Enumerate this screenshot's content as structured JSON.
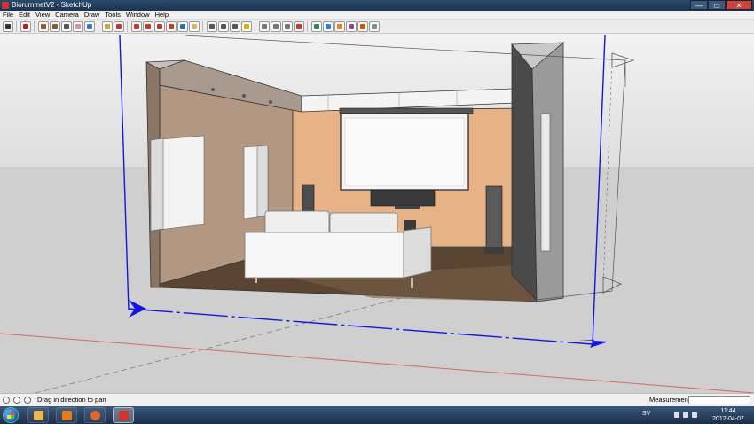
{
  "window": {
    "title": "BiorummetV2 - SketchUp",
    "minimize": "—",
    "maximize": "▭",
    "close": "✕"
  },
  "menu": [
    "File",
    "Edit",
    "View",
    "Camera",
    "Draw",
    "Tools",
    "Window",
    "Help"
  ],
  "toolbar": {
    "tools": [
      {
        "name": "select-tool",
        "color": "#333333"
      },
      {
        "name": "line-tool",
        "color": "#b22222"
      },
      {
        "name": "rectangle-tool",
        "color": "#8b5a2b"
      },
      {
        "name": "circle-tool",
        "color": "#8b5a2b"
      },
      {
        "name": "arc-tool",
        "color": "#555555"
      },
      {
        "name": "eraser-tool",
        "color": "#d98cb3"
      },
      {
        "name": "paint-bucket-tool",
        "color": "#3a7bd5"
      },
      {
        "name": "push-pull-tool",
        "color": "#c8a04a"
      },
      {
        "name": "move-tool",
        "color": "#c0392b"
      },
      {
        "name": "rotate-tool",
        "color": "#c0392b"
      },
      {
        "name": "follow-me-tool",
        "color": "#c0392b"
      },
      {
        "name": "scale-tool",
        "color": "#c0392b"
      },
      {
        "name": "offset-tool",
        "color": "#c0392b"
      },
      {
        "name": "orbit-tool",
        "color": "#2a6fb0"
      },
      {
        "name": "pan-tool",
        "color": "#e0b070"
      },
      {
        "name": "zoom-tool",
        "color": "#555555"
      },
      {
        "name": "zoom-window-tool",
        "color": "#555555"
      },
      {
        "name": "zoom-extents-tool",
        "color": "#555555"
      },
      {
        "name": "tape-measure-tool",
        "color": "#d4b000"
      },
      {
        "name": "dimension-tool",
        "color": "#777777"
      },
      {
        "name": "protractor-tool",
        "color": "#777777"
      },
      {
        "name": "text-tool",
        "color": "#777777"
      },
      {
        "name": "axes-tool",
        "color": "#c0392b"
      },
      {
        "name": "walk-tool",
        "color": "#2e8b57"
      },
      {
        "name": "look-around-tool",
        "color": "#3a7bd5"
      },
      {
        "name": "section-plane-tool",
        "color": "#e67e22"
      },
      {
        "name": "components-tool",
        "color": "#8e44ad"
      },
      {
        "name": "materials-tool",
        "color": "#d35400"
      },
      {
        "name": "styles-tool",
        "color": "#7f8c8d"
      }
    ]
  },
  "status": {
    "hint": "Drag in direction to pan",
    "measurements_label": "Measurements",
    "measurements_value": ""
  },
  "taskbar": {
    "apps": [
      {
        "name": "explorer",
        "color": "#e8b84a"
      },
      {
        "name": "media-player",
        "color": "#e87a1a"
      },
      {
        "name": "firefox",
        "color": "#e0662a"
      },
      {
        "name": "sketchup",
        "color": "#d8302a"
      }
    ],
    "language": "SV",
    "time": "11:44",
    "date": "2012-04-07"
  },
  "colors": {
    "sky": "#e8e8e8",
    "ground": "#cfcfcf",
    "back_wall": "#e7b286",
    "left_wall": "#b29883",
    "floor": "#5a4533",
    "screen": "#f4f4f4",
    "sofa": "#f2f2f2",
    "axis_blue": "#1515e0",
    "axis_red": "#d06a6a"
  }
}
